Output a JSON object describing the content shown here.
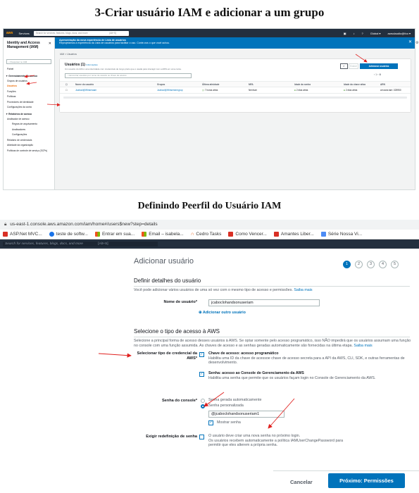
{
  "headings": {
    "section1": "3-Criar usuário IAM e adicionar a um grupo",
    "section2": "Definindo Peerfil do Usuário IAM"
  },
  "shot1": {
    "topbar": {
      "logo": "aws",
      "services": "Services",
      "search_placeholder": "Search for services, features, blogs, docs, and more",
      "shortcut": "[Alt+S]",
      "account": "Global ▾",
      "user": "awsclaudio@foo ▾"
    },
    "sidebar": {
      "title": "Identity and Access Management (IAM)",
      "search": "Pesquisar no IAM",
      "items": {
        "painel": "Painel",
        "ger_acesso": "▼ Gerenciamento de acesso",
        "grupos": "Grupos de usuários",
        "usuarios": "Usuários",
        "funcoes": "Funções",
        "politicas": "Políticas",
        "provedores": "Provedores de identidade",
        "config": "Configurações da conta",
        "relatorios": "▼ Relatórios de acesso",
        "analisador": "Analisador de acesso",
        "regras": "Regras de arquivamento",
        "analisadores": "Analisadores",
        "config2": "Configurações",
        "credenciais": "Relatório de credenciais",
        "atividade": "Atividade da organização",
        "scp": "Políticas de controle de serviço (SCPs)"
      }
    },
    "banner": {
      "title": "Apresentação da nova experiência de Lista de usuários",
      "text": "Reprojetamos a experiência da Lista de usuários para facilitar o uso. Conte-nos o que você achou.",
      "close": "✕"
    },
    "breadcrumb": "IAM  >  Usuários",
    "panel": {
      "title": "Usuários (1)",
      "info": "Informações",
      "desc": "Um usuário do IAM é uma identidade com credenciais de longo prazo que é usada para interagir com a AWS em uma conta.",
      "refresh": "⟳",
      "delete": "Excluir",
      "add": "Adicionar usuários",
      "search": "Encontrar usuários por nome de usuário ou chave de acesso",
      "pager": "‹  1  ›   ⚙",
      "columns": [
        "Nome do usuário",
        "Grupos",
        "Última atividade",
        "MFA",
        "Idade da senha",
        "Idade da chave ativa",
        "ARN"
      ],
      "rows": [
        [
          "Jcabocl@Whiseraam",
          "Jcabocl@Whiserserngrup",
          "7 horas atrás",
          "Nenhum",
          "2 dias atrás",
          "2 dias atrás",
          "arn:aws:iam::325950"
        ]
      ]
    }
  },
  "shot2": {
    "url": "us-east-1.console.aws.amazon.com/iam/home#/users$new?step=details",
    "bookmarks": [
      "ASP.Net MVC...",
      "teste de softw...",
      "Entrar em sua...",
      "Email – isabela...",
      "Cedro Tasks",
      "Como Vencer...",
      "Amantes Liber...",
      "Série Nossa Vi..."
    ],
    "search_placeholder": "Search for services, features, blogs, docs, and more",
    "search_shortcut": "[Alt+S]",
    "page_title": "Adicionar usuário",
    "steps": [
      "1",
      "2",
      "3",
      "4",
      "5"
    ],
    "details": {
      "title": "Definir detalhes do usuário",
      "desc": "Você pode adicionar vários usuários de uma só vez com o mesmo tipo de acesso e permissões.",
      "learn_more": "Saiba mais",
      "username_label": "Nome de usuário*",
      "username_value": "jcaboclohandsonuseriam",
      "add_another": "Adicionar outro usuário"
    },
    "access": {
      "title": "Selecione o tipo de acesso à AWS",
      "desc": "Selecione a principal forma de acesso desses usuários à AWS. Se optar somente pelo acesso programático, isso NÃO impedirá que os usuários assumam uma função no console com uma função assumida. As chaves de acesso e as senhas geradas automaticamente são fornecidas na última etapa.",
      "learn_more": "Saiba mais",
      "type_label": "Selecionar tipo de credencial da AWS*",
      "opt1_title": "Chave de acesso: acesso programático",
      "opt1_desc": "Habilita uma ID da chave de acessoe chave de acesso secreta para a API da AWS, CLI, SDK, e outras ferramentas de desenvolvimento.",
      "opt2_title": "Senha: acesso ao Console de Gerenciamento da AWS",
      "opt2_desc": "Habilita uma senha que permite que os usuários façam login no Console de Gerenciamento da AWS.",
      "pwd_label": "Senha do console*",
      "pwd_auto": "Senha gerada automaticamente",
      "pwd_custom": "Senha personalizada",
      "pwd_value": "@jcaboclohandsonuseriam1",
      "show_pwd": "Mostrar senha",
      "reset_label": "Exigir redefinição de senha",
      "reset_text": "O usuário deve criar uma nova senha no próximo login.",
      "reset_text2": "Os usuários recebem automaticamente a política IAMUserChangePassword para permitir que eles alterem a própria senha.",
      "policy_link": "IAMUserChangePassword"
    },
    "buttons": {
      "cancel": "Cancelar",
      "next": "Próximo: Permissões"
    }
  },
  "colors": {
    "aws_dark": "#232f3e",
    "aws_blue": "#0073bb",
    "aws_orange": "#ec7211",
    "annotation_red": "#e0201e"
  }
}
